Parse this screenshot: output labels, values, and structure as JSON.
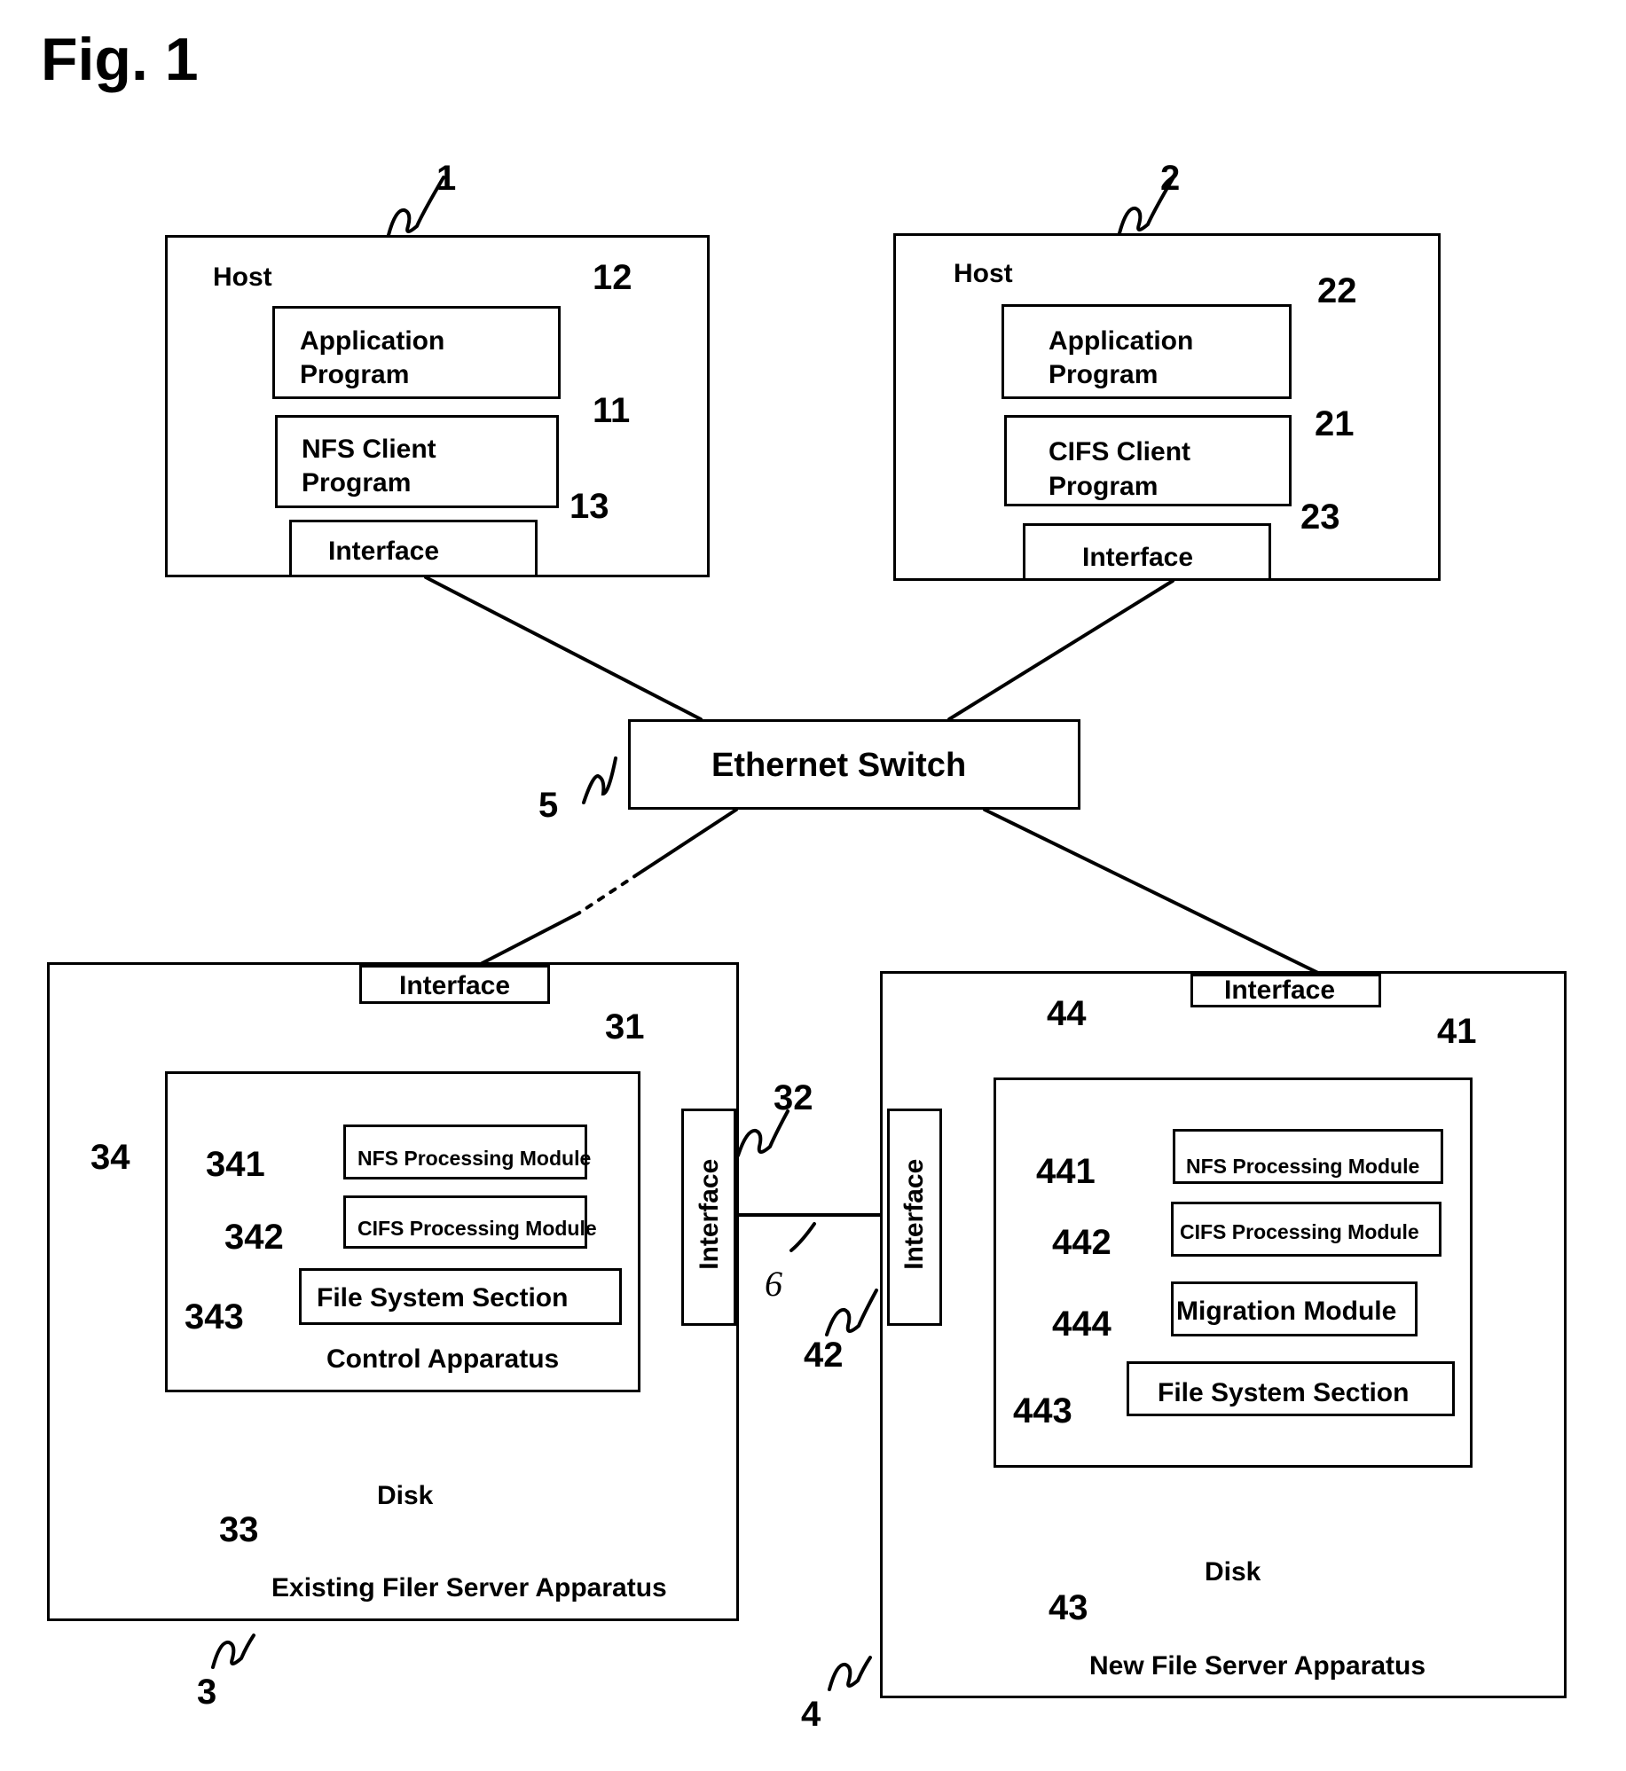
{
  "figure": {
    "title": "Fig. 1"
  },
  "host1": {
    "ref": "1",
    "label": "Host",
    "app": {
      "ref": "12",
      "line1": "Application",
      "line2": "Program"
    },
    "client": {
      "ref": "11",
      "line1": "NFS Client",
      "line2": "Program"
    },
    "iface": {
      "ref": "13",
      "label": "Interface"
    }
  },
  "host2": {
    "ref": "2",
    "label": "Host",
    "app": {
      "ref": "22",
      "line1": "Application",
      "line2": "Program"
    },
    "client": {
      "ref": "21",
      "line1": "CIFS Client",
      "line2": "Program"
    },
    "iface": {
      "ref": "23",
      "label": "Interface"
    }
  },
  "switch": {
    "ref": "5",
    "label": "Ethernet Switch"
  },
  "existing": {
    "ref": "3",
    "label": "Existing Filer Server Apparatus",
    "iface_top": {
      "ref": "31",
      "label": "Interface"
    },
    "iface_side": {
      "ref": "32",
      "label": "Interface"
    },
    "control": {
      "ref": "34",
      "label": "Control Apparatus"
    },
    "nfs": {
      "ref": "341",
      "label": "NFS Processing Module"
    },
    "cifs": {
      "ref": "342",
      "label": "CIFS Processing Module"
    },
    "fs": {
      "ref": "343",
      "label": "File System Section"
    },
    "disk": {
      "ref": "33",
      "label": "Disk"
    }
  },
  "link": {
    "ref": "6"
  },
  "newfs": {
    "ref": "4",
    "label": "New File Server Apparatus",
    "iface_top": {
      "ref": "41",
      "label": "Interface"
    },
    "iface_side": {
      "ref": "42",
      "label": "Interface"
    },
    "control": {
      "ref": "44"
    },
    "nfs": {
      "ref": "441",
      "label": "NFS Processing Module"
    },
    "cifs": {
      "ref": "442",
      "label": "CIFS Processing Module"
    },
    "migration": {
      "ref": "444",
      "label": "Migration Module"
    },
    "fs": {
      "ref": "443",
      "label": "File System Section"
    },
    "disk": {
      "ref": "43",
      "label": "Disk"
    }
  }
}
